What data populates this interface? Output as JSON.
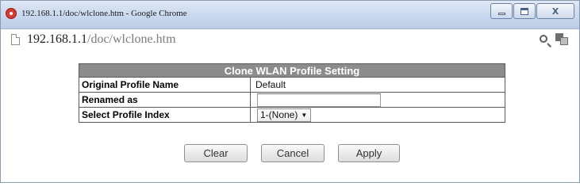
{
  "window": {
    "title": "192.168.1.1/doc/wlclone.htm - Google Chrome",
    "controls": {
      "close_label": "X"
    }
  },
  "address_bar": {
    "host": "192.168.1.1",
    "path": "/doc/wlclone.htm"
  },
  "form": {
    "title": "Clone WLAN Profile Setting",
    "rows": [
      {
        "label": "Original Profile Name",
        "value": "Default"
      },
      {
        "label": "Renamed as",
        "value": ""
      },
      {
        "label": "Select Profile Index",
        "selected": "1-(None)"
      }
    ]
  },
  "buttons": {
    "clear": "Clear",
    "cancel": "Cancel",
    "apply": "Apply"
  }
}
